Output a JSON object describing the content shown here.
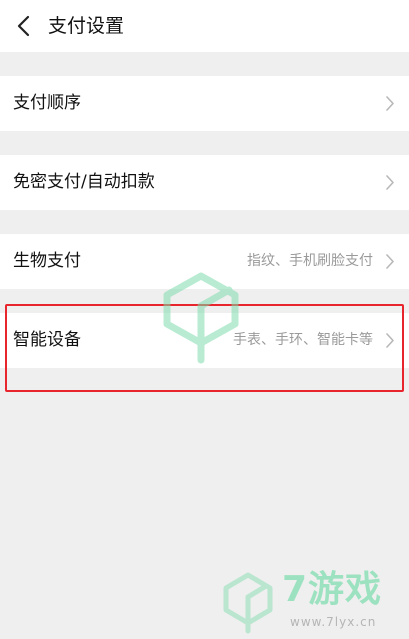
{
  "header": {
    "title": "支付设置"
  },
  "settings": [
    {
      "label": "支付顺序",
      "value": ""
    },
    {
      "label": "免密支付/自动扣款",
      "value": ""
    },
    {
      "label": "生物支付",
      "value": "指纹、手机刷脸支付"
    },
    {
      "label": "智能设备",
      "value": "手表、手环、智能卡等"
    }
  ],
  "watermark": {
    "brand": "7游戏",
    "url": "www.7lyx.cn"
  },
  "colors": {
    "highlight": "#e8242c",
    "watermark": "#8fe0b8"
  }
}
